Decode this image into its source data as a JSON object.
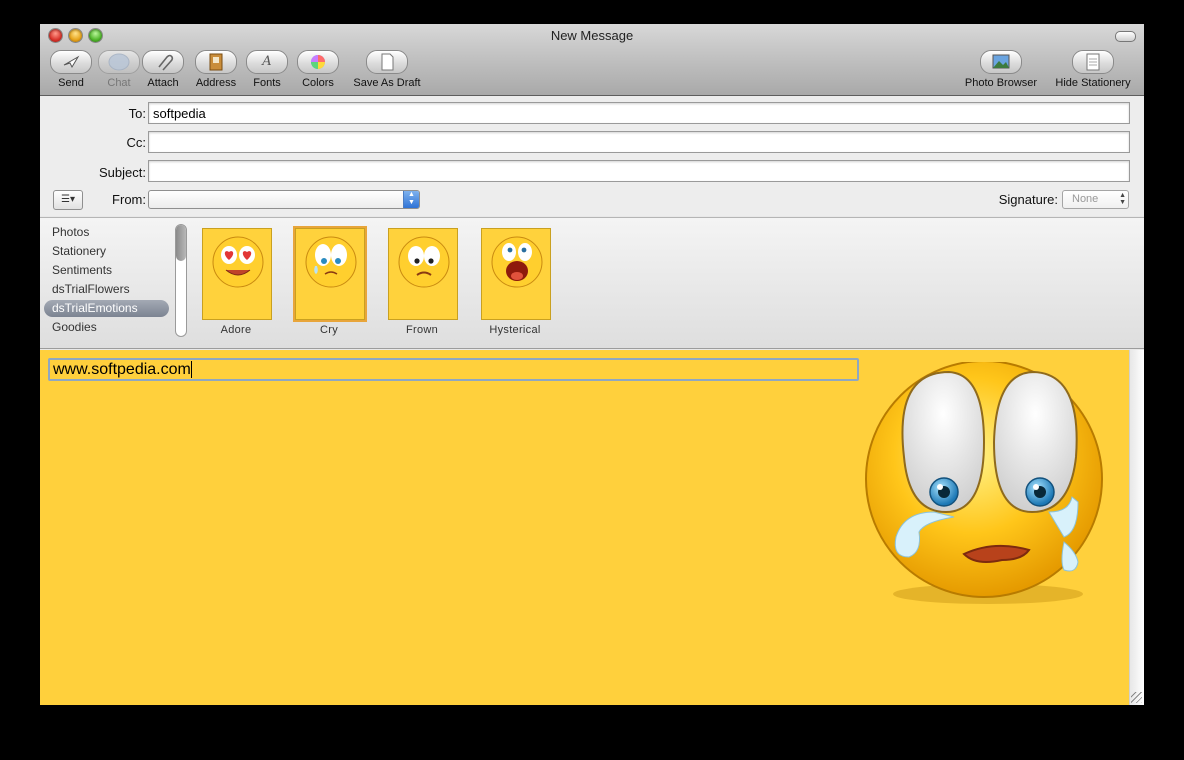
{
  "window": {
    "title": "New Message"
  },
  "toolbar": {
    "send": "Send",
    "chat": "Chat",
    "attach": "Attach",
    "address": "Address",
    "fonts": "Fonts",
    "colors": "Colors",
    "save_as_draft": "Save As Draft",
    "photo_browser": "Photo Browser",
    "hide_stationery": "Hide Stationery"
  },
  "header": {
    "to_label": "To:",
    "to_value": "softpedia",
    "cc_label": "Cc:",
    "cc_value": "",
    "subject_label": "Subject:",
    "subject_value": "",
    "from_label": "From:",
    "from_value": "",
    "signature_label": "Signature:",
    "signature_value": "None"
  },
  "stationery": {
    "categories": [
      "Photos",
      "Stationery",
      "Sentiments",
      "dsTrialFlowers",
      "dsTrialEmotions",
      "Goodies"
    ],
    "selected_category": "dsTrialEmotions",
    "items": [
      {
        "name": "Adore"
      },
      {
        "name": "Cry"
      },
      {
        "name": "Frown"
      },
      {
        "name": "Hysterical"
      }
    ],
    "selected_item": "Cry"
  },
  "body": {
    "text": "www.softpedia.com"
  },
  "colors": {
    "body_background": "#ffd03c",
    "selected_blue": "#3b7ad9"
  }
}
